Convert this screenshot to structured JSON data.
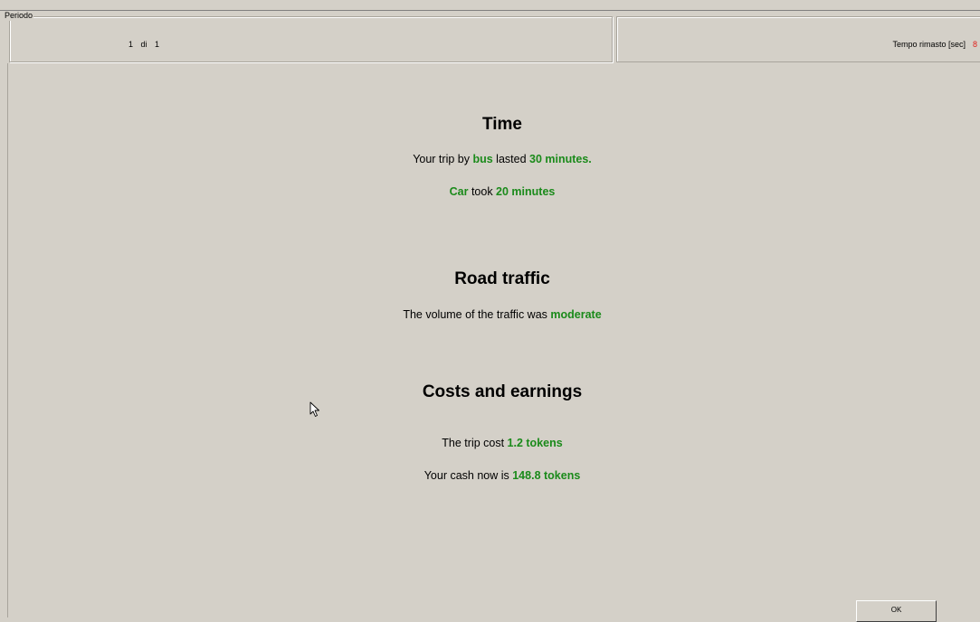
{
  "period": {
    "legend": "Periodo",
    "value": "1 di 1"
  },
  "timer": {
    "label": "Tempo rimasto [sec]",
    "value": "8"
  },
  "time_section": {
    "title": "Time",
    "line1": {
      "prefix": "Your trip by ",
      "mode": "bus",
      "middle": " lasted ",
      "duration": "30 minutes."
    },
    "line2": {
      "mode": "Car",
      "middle": " took ",
      "duration": "20 minutes"
    }
  },
  "traffic_section": {
    "title": "Road traffic",
    "line1": {
      "prefix": "The volume of the traffic was ",
      "level": "moderate"
    }
  },
  "costs_section": {
    "title": "Costs and earnings",
    "line1": {
      "prefix": "The trip cost ",
      "amount": "1.2 tokens"
    },
    "line2": {
      "prefix": "Your cash now is ",
      "amount": "148.8 tokens"
    }
  },
  "buttons": {
    "ok_label": "OK"
  },
  "colors": {
    "background": "#d4d0c8",
    "highlight": "#1a8a1a",
    "timer_value": "#e0201c"
  }
}
